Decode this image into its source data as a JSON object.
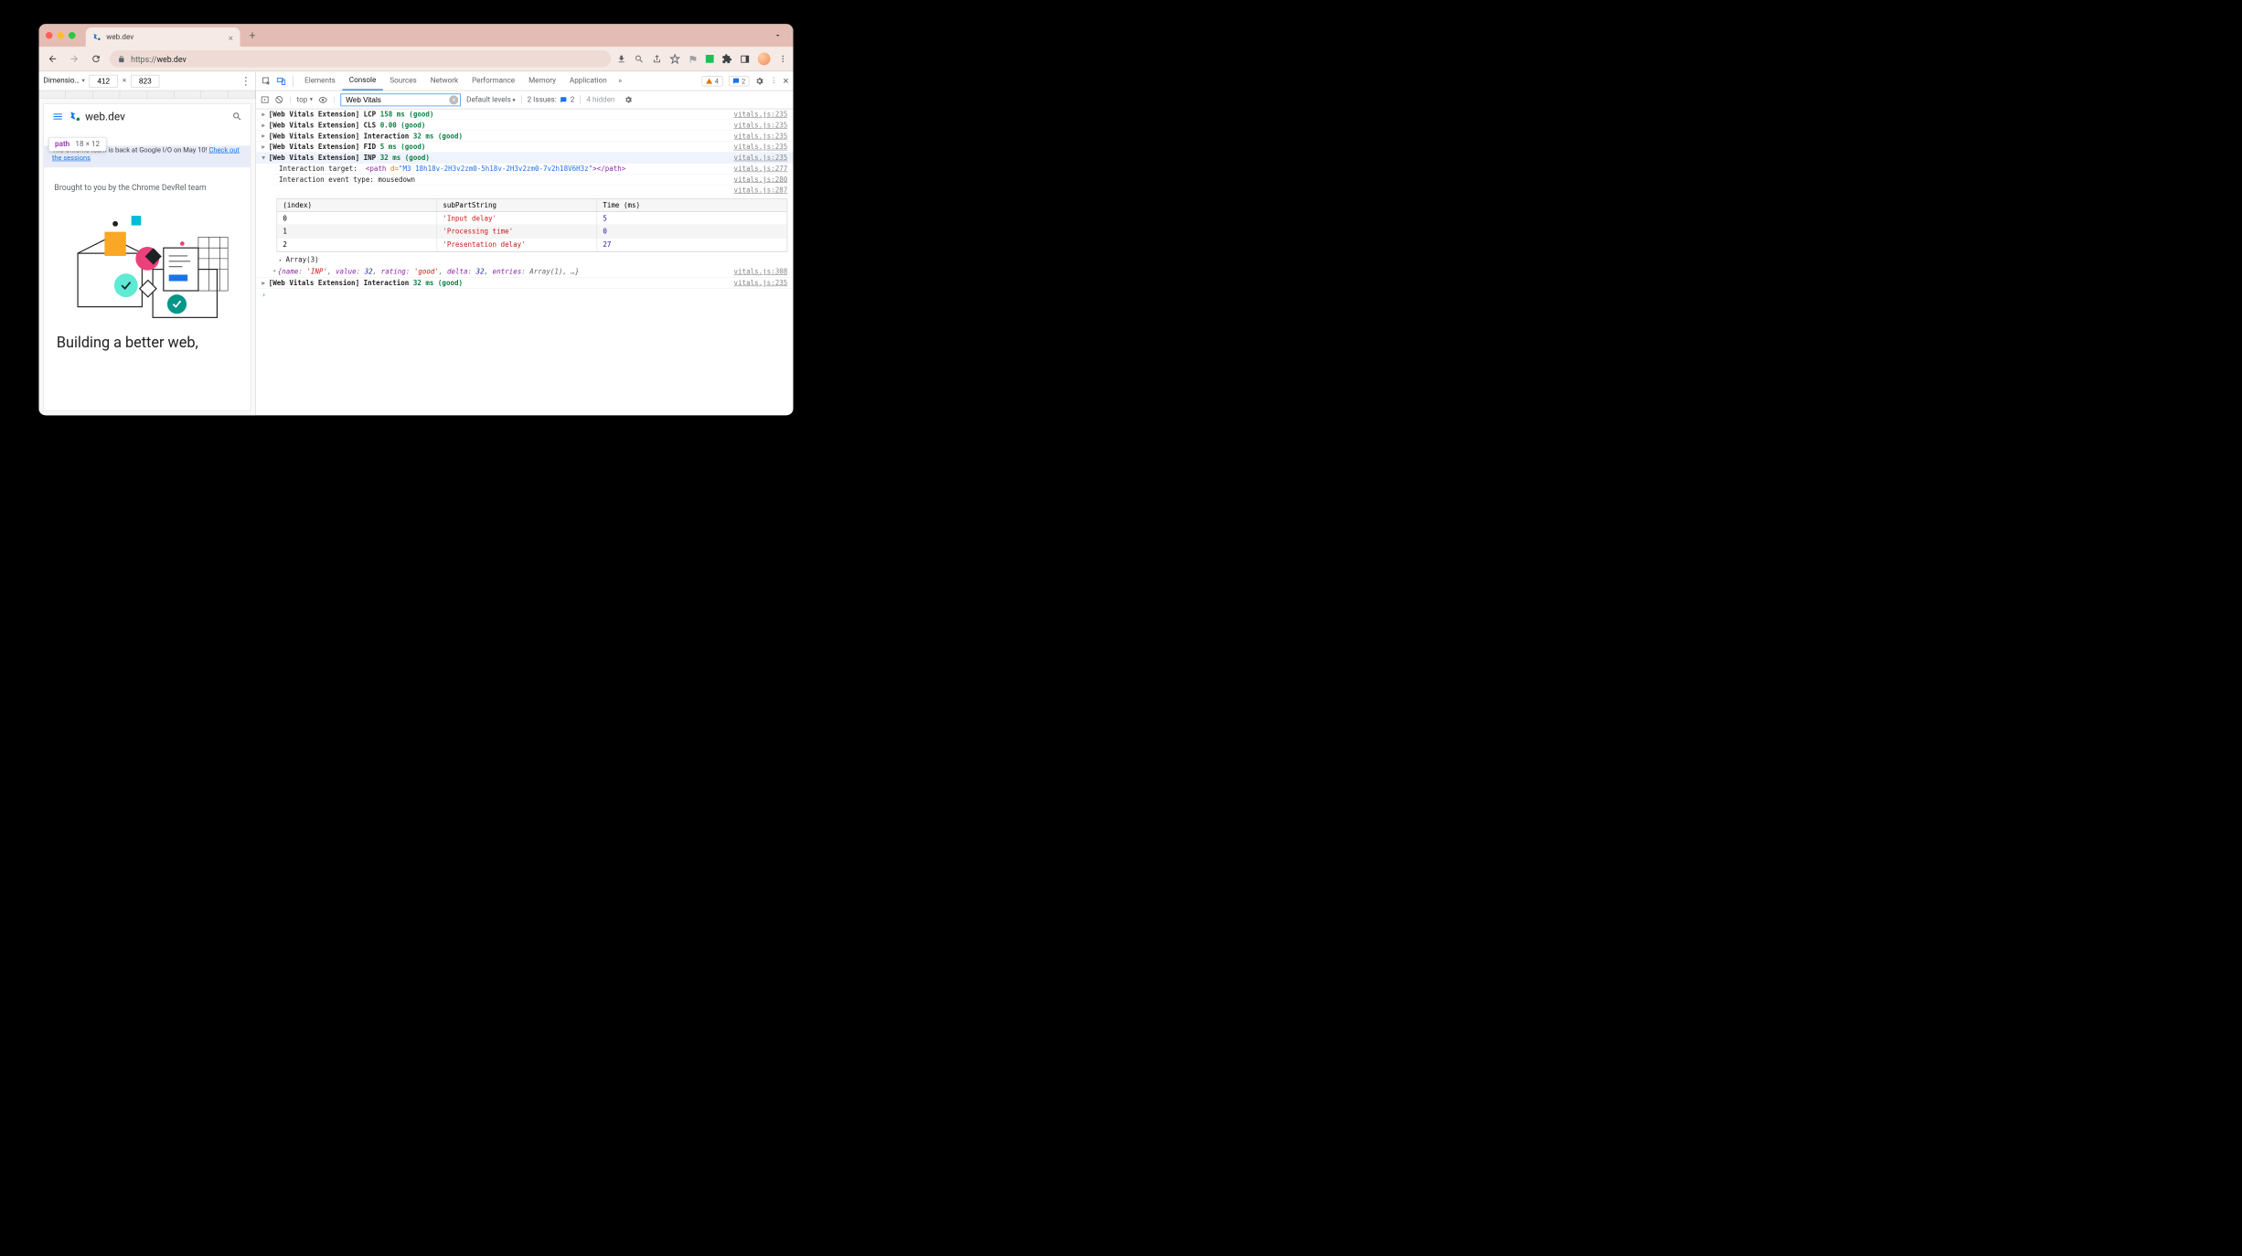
{
  "browser_tab": {
    "title": "web.dev"
  },
  "url": {
    "scheme": "https://",
    "host": "web.dev"
  },
  "device_toolbar": {
    "label": "Dimensio…",
    "width": "412",
    "height": "823"
  },
  "preview": {
    "brand": "web.dev",
    "tooltip_element": "path",
    "tooltip_size": "18 × 12",
    "banner_text": "The Chrome team is back at Google I/O on May 10! ",
    "banner_link": "Check out the sessions",
    "hero_caption": "Brought to you by the Chrome DevRel team",
    "hero_title": "Building a better web,"
  },
  "devtools": {
    "tabs": [
      "Elements",
      "Console",
      "Sources",
      "Network",
      "Performance",
      "Memory",
      "Application"
    ],
    "active_tab": "Console",
    "warnings_count": "4",
    "messages_count": "2",
    "filter_value": "Web Vitals",
    "context": "top",
    "levels": "Default levels",
    "issues_label": "2 Issues:",
    "issues_count": "2",
    "hidden": "4 hidden"
  },
  "logs": [
    {
      "prefix": "[Web Vitals Extension]",
      "metric": "LCP",
      "value": "158 ms (good)",
      "src": "vitals.js:235"
    },
    {
      "prefix": "[Web Vitals Extension]",
      "metric": "CLS",
      "value": "0.00 (good)",
      "src": "vitals.js:235"
    },
    {
      "prefix": "[Web Vitals Extension]",
      "metric": "Interaction",
      "value": "32 ms (good)",
      "src": "vitals.js:235"
    },
    {
      "prefix": "[Web Vitals Extension]",
      "metric": "FID",
      "value": "5 ms (good)",
      "src": "vitals.js:235"
    },
    {
      "prefix": "[Web Vitals Extension]",
      "metric": "INP",
      "value": "32 ms (good)",
      "src": "vitals.js:235",
      "expanded": true
    }
  ],
  "inp_details": {
    "target_label": "Interaction target:",
    "target_tag": "<path ",
    "target_attr": "d=",
    "target_val": "\"M3 18h18v-2H3v2zm0-5h18v-2H3v2zm0-7v2h18V6H3z\"",
    "target_close": "></path>",
    "target_src": "vitals.js:277",
    "event_label": "Interaction event type:",
    "event_value": "mousedown",
    "event_src": "vitals.js:280",
    "table_src": "vitals.js:287",
    "table_headers": [
      "(index)",
      "subPartString",
      "Time (ms)"
    ],
    "table_rows": [
      {
        "idx": "0",
        "part": "'Input delay'",
        "time": "5"
      },
      {
        "idx": "1",
        "part": "'Processing time'",
        "time": "0"
      },
      {
        "idx": "2",
        "part": "'Presentation delay'",
        "time": "27"
      }
    ],
    "array_caption": "Array(3)",
    "obj_summary": "{name: 'INP', value: 32, rating: 'good', delta: 32, entries: Array(1), …}",
    "obj_src": "vitals.js:308"
  },
  "logs_after": [
    {
      "prefix": "[Web Vitals Extension]",
      "metric": "Interaction",
      "value": "32 ms (good)",
      "src": "vitals.js:235"
    }
  ]
}
